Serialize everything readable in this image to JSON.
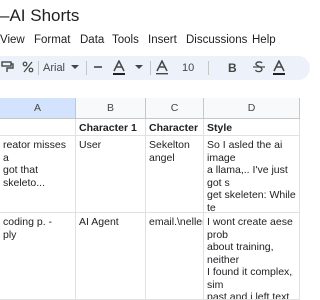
{
  "title": "–AI Shorts",
  "menu": [
    "View",
    "Format",
    "Data",
    "Tools",
    "Insert",
    "Discussions",
    "Help"
  ],
  "toolbar": {
    "font": "Arial",
    "font_size": "10",
    "bold": "B",
    "text_color": "A"
  },
  "columns": [
    "A",
    "B",
    "C",
    "D"
  ],
  "rows": [
    {
      "a": "",
      "b": "Character 1",
      "c": "Character 2",
      "d": "Style"
    },
    {
      "a": "reator misses a\n got that skeleto...",
      "b": "User",
      "c": "Sekelton\nangel",
      "d": "So I asled the ai image\na llama,.. I've just got s\nget skeleten: While te\ndisplayed on the scree\ndark green backgroun\ncase standard partition"
    },
    {
      "a": "coding p. -\nply",
      "b": "AI Agent",
      "c": "email.\\neller",
      "d": "I wont create aese prob\nabout training, neither\nI found it complex, sim\npast and i left text disp\nText over a dark green\nwritten title case stand"
    }
  ]
}
